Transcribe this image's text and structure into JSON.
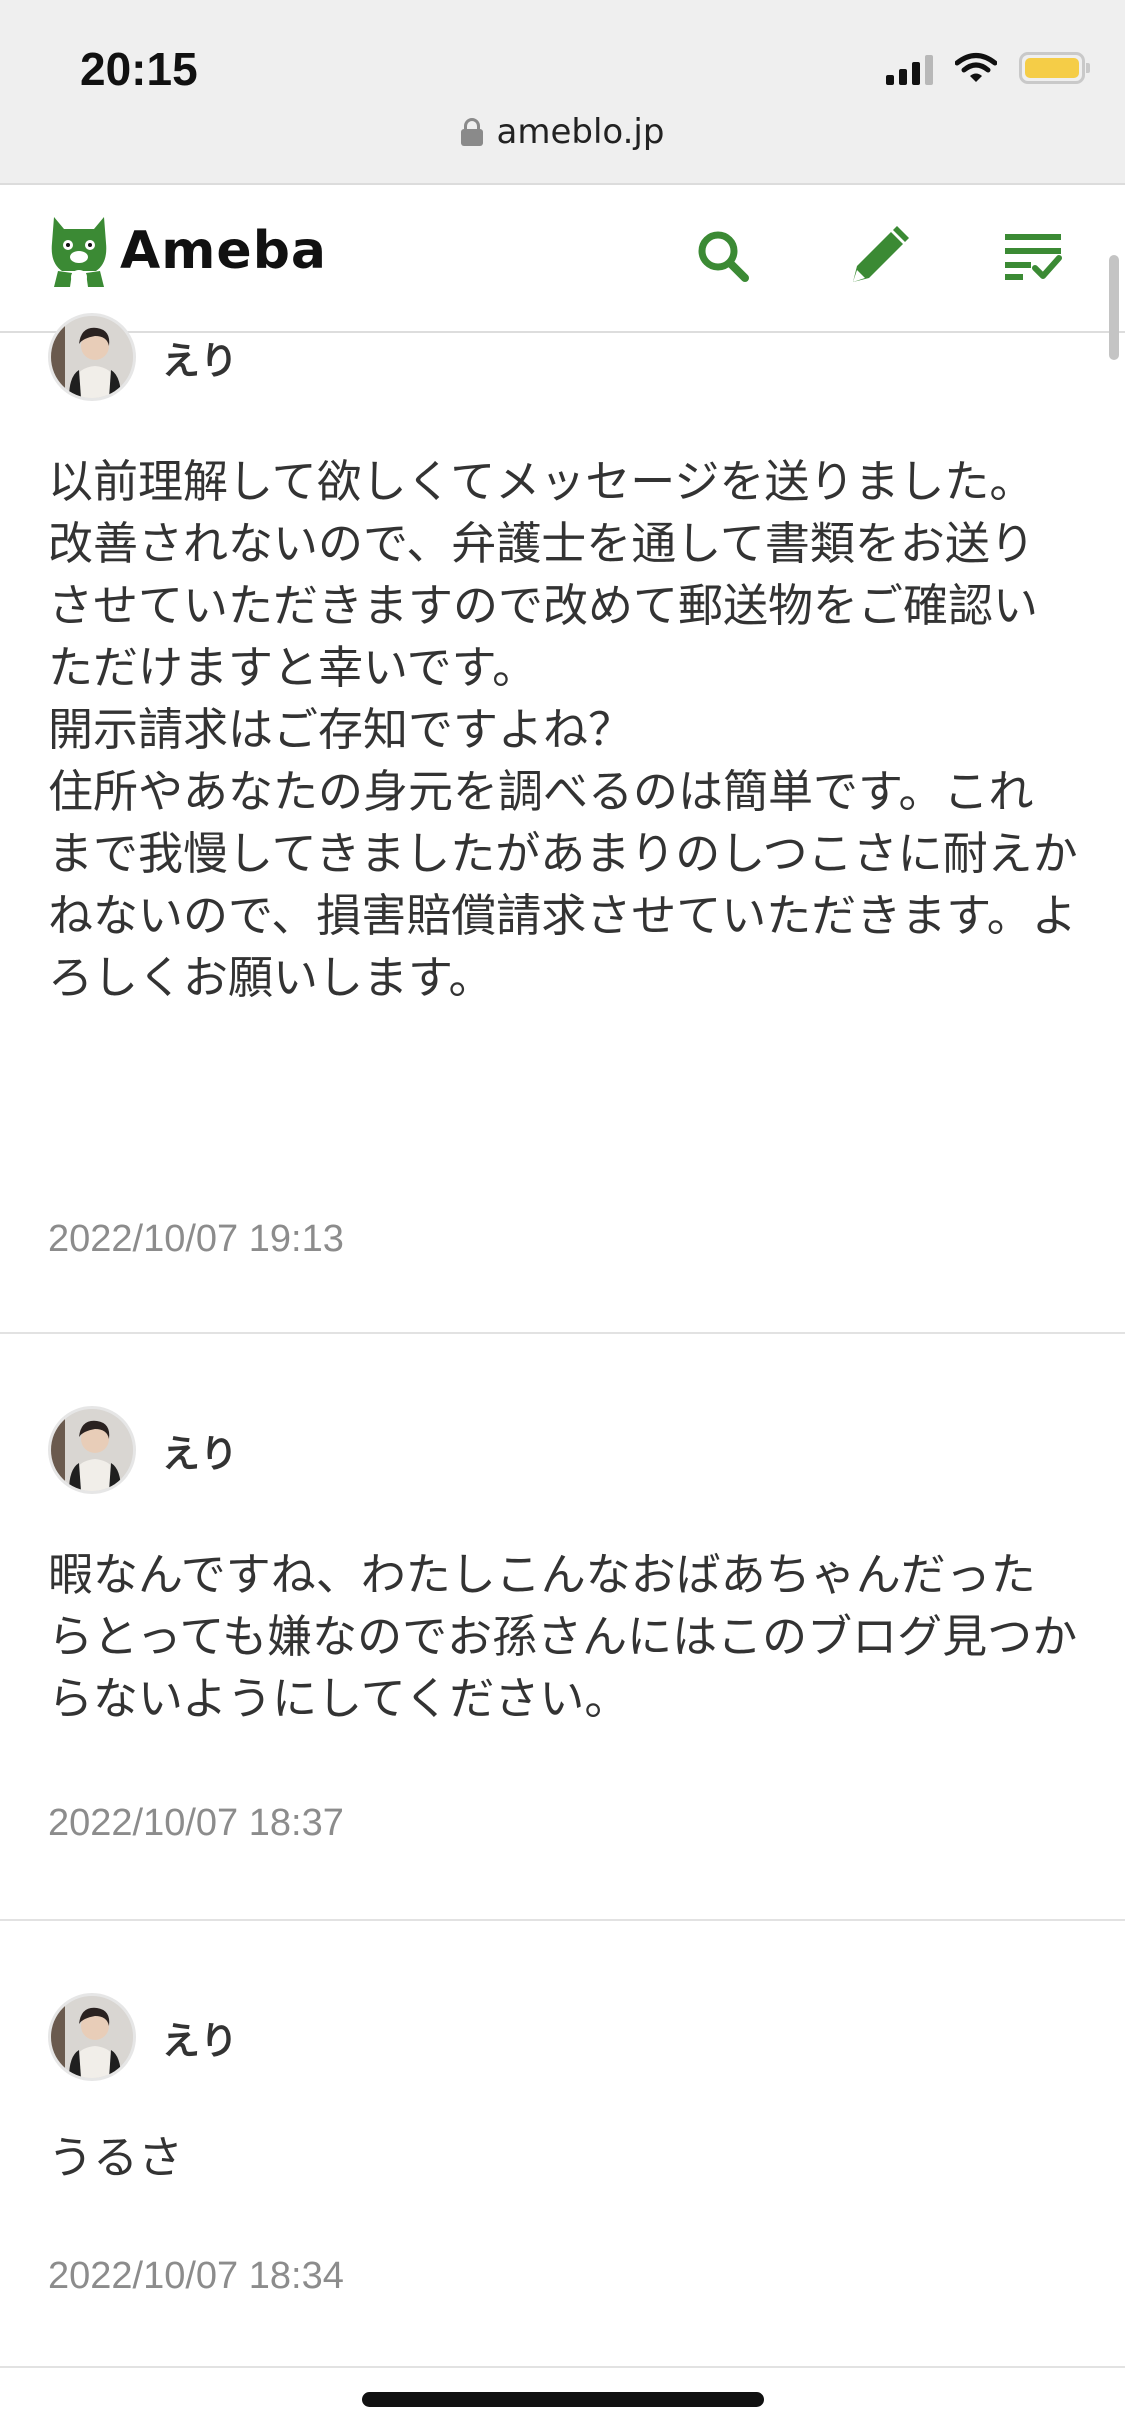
{
  "status_bar": {
    "time": "20:15",
    "url": "ameblo.jp",
    "battery_color": "#f5cd47"
  },
  "header": {
    "logo_text": "Ameba",
    "brand_color": "#3b8a34",
    "icons": [
      "search-icon",
      "pencil-icon",
      "feed-list-icon"
    ]
  },
  "comments": [
    {
      "author": "えり",
      "body": "以前理解して欲しくてメッセージを送りました。\n改善されないので、弁護士を通して書類をお送りさせていただきますので改めて郵送物をご確認いただけますと幸いです。\n開示請求はご存知ですよね？\n住所やあなたの身元を調べるのは簡単です。これまで我慢してきましたがあまりのしつこさに耐えかねないので、損害賠償請求させていただきます。よろしくお願いします。",
      "date": "2022/10/07 19:13"
    },
    {
      "author": "えり",
      "body": "暇なんですね、わたしこんなおばあちゃんだったらとっても嫌なのでお孫さんにはこのブログ見つからないようにしてください。",
      "date": "2022/10/07 18:37"
    },
    {
      "author": "えり",
      "body": "うるさ",
      "date": "2022/10/07 18:34"
    }
  ]
}
